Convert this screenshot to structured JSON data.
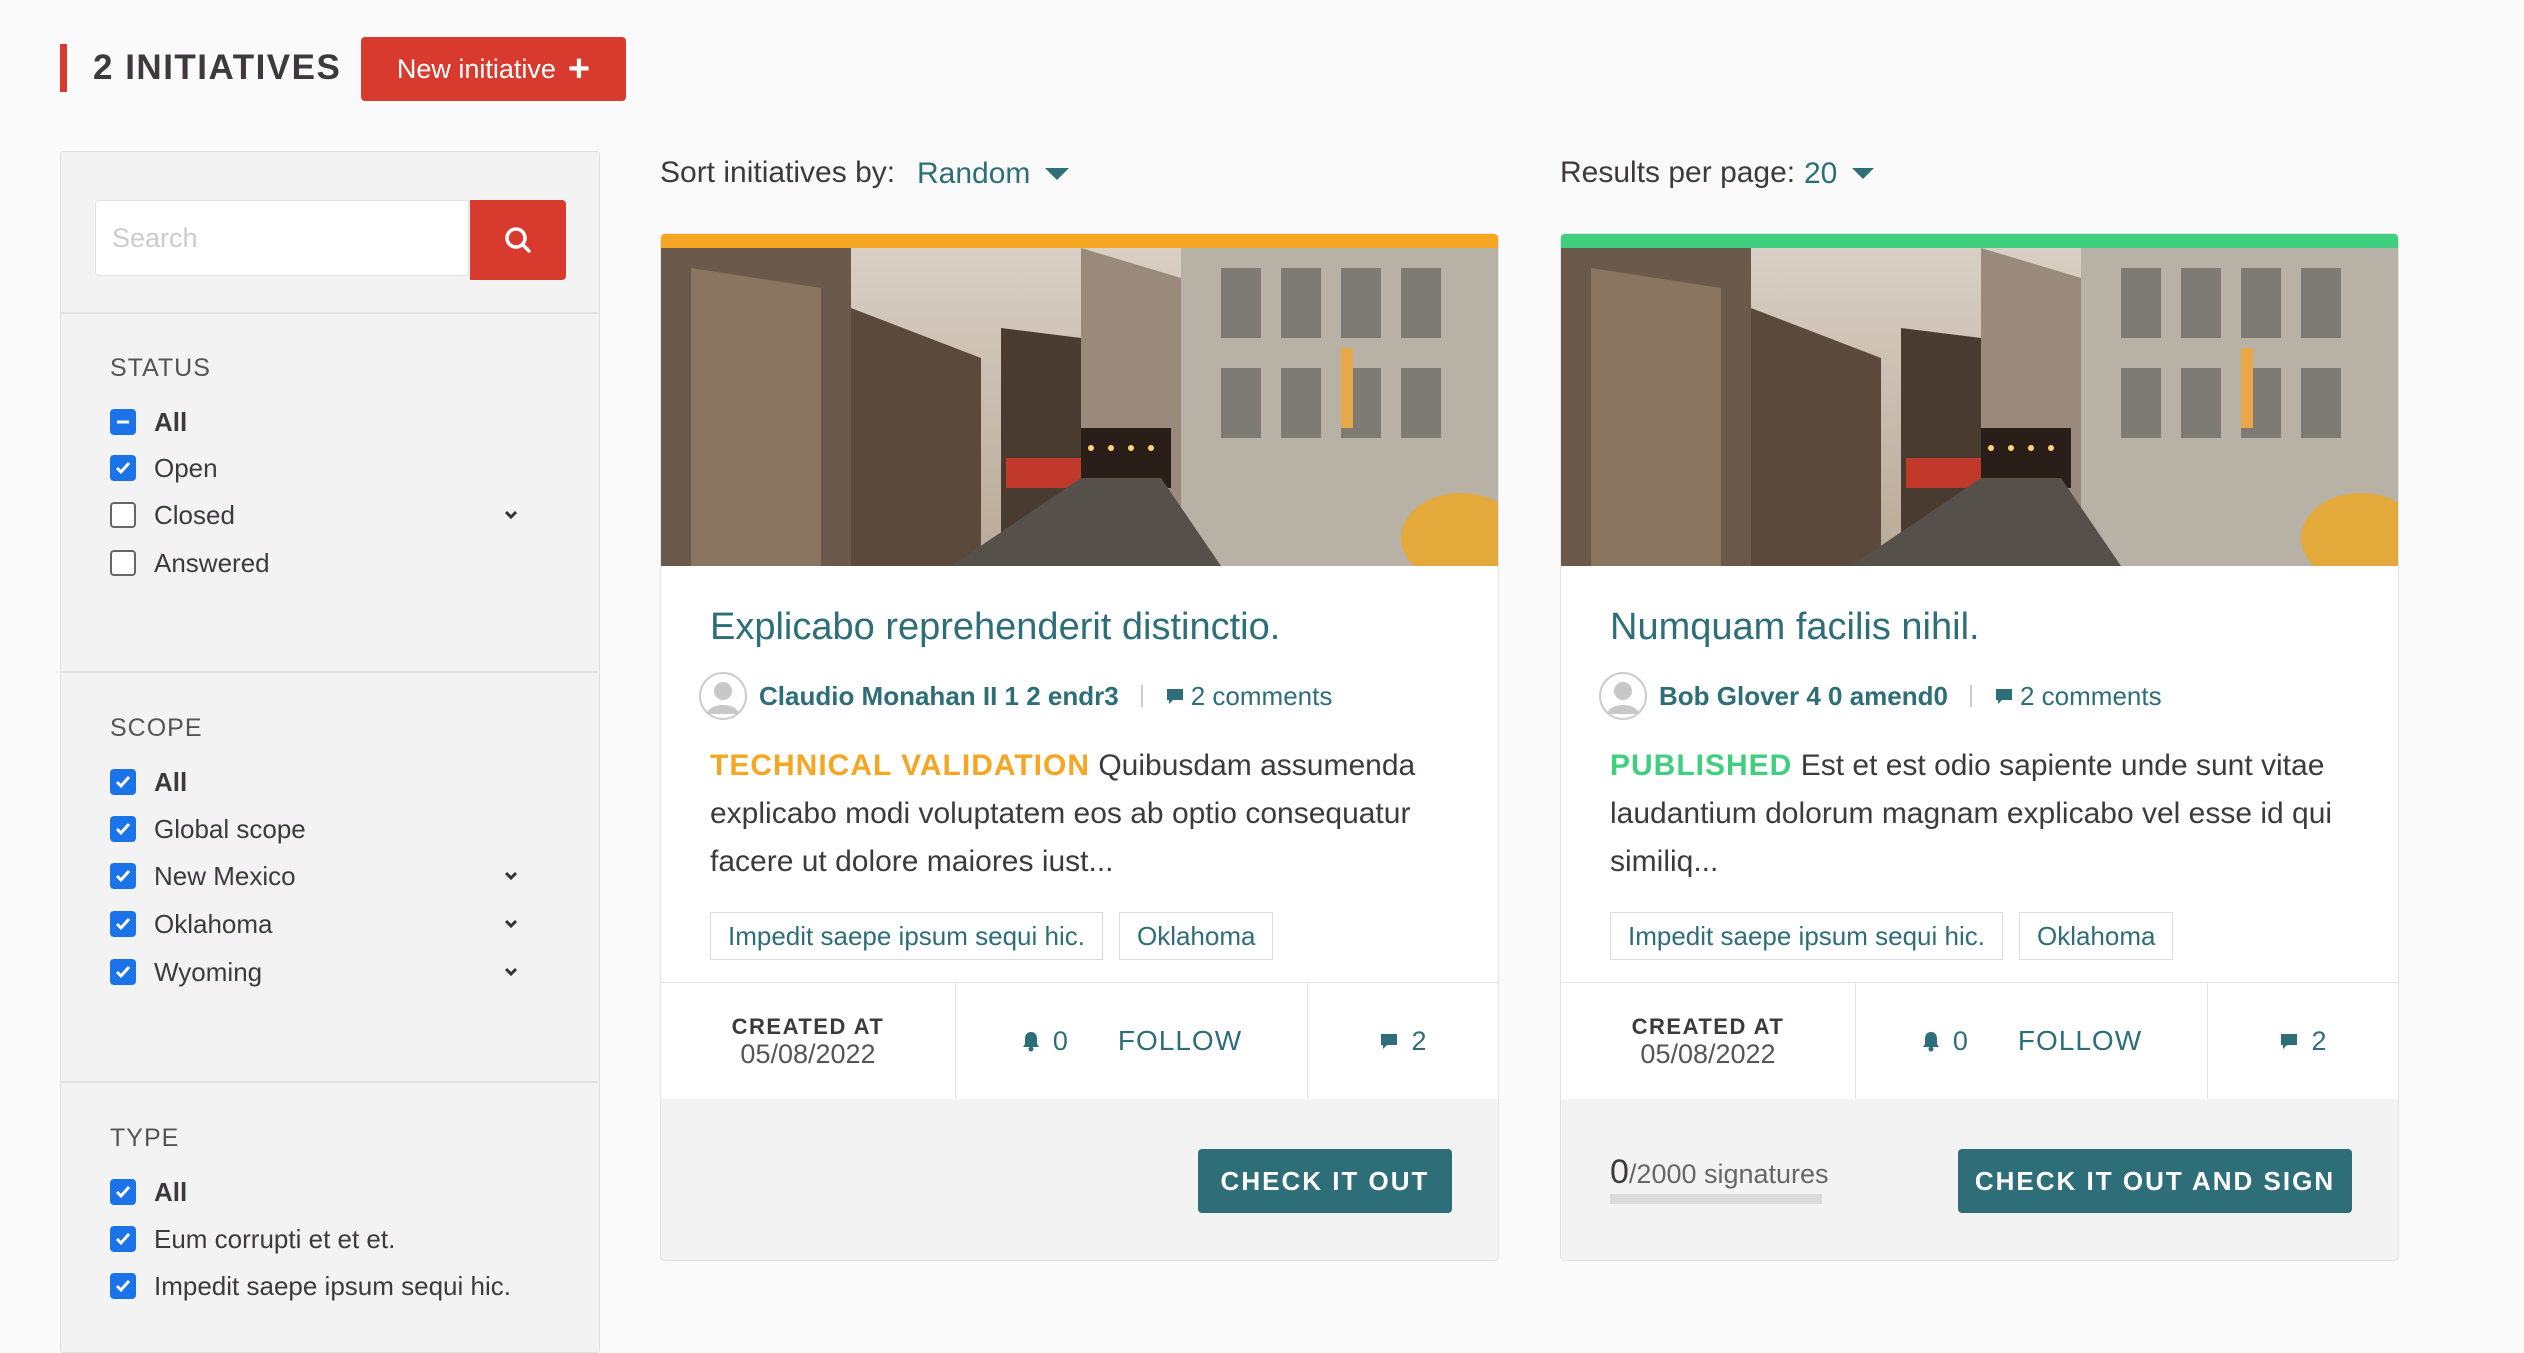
{
  "header": {
    "title": "2 INITIATIVES",
    "new_button": "New initiative",
    "accent": "#d93a2e"
  },
  "search": {
    "placeholder": "Search"
  },
  "filters": {
    "status": {
      "title": "STATUS",
      "items": [
        {
          "label": "All",
          "state": "indeterminate"
        },
        {
          "label": "Open",
          "state": "checked"
        },
        {
          "label": "Closed",
          "state": "unchecked",
          "expandable": true
        },
        {
          "label": "Answered",
          "state": "unchecked"
        }
      ]
    },
    "scope": {
      "title": "SCOPE",
      "items": [
        {
          "label": "All",
          "state": "checked"
        },
        {
          "label": "Global scope",
          "state": "checked"
        },
        {
          "label": "New Mexico",
          "state": "checked",
          "expandable": true
        },
        {
          "label": "Oklahoma",
          "state": "checked",
          "expandable": true
        },
        {
          "label": "Wyoming",
          "state": "checked",
          "expandable": true
        }
      ]
    },
    "type": {
      "title": "TYPE",
      "items": [
        {
          "label": "All",
          "state": "checked"
        },
        {
          "label": "Eum corrupti et et et.",
          "state": "checked"
        },
        {
          "label": "Impedit saepe ipsum sequi hic.",
          "state": "checked"
        }
      ]
    }
  },
  "controls": {
    "sort_label": "Sort initiatives by:",
    "sort_value": "Random",
    "per_page_label": "Results per page:",
    "per_page_value": "20"
  },
  "cards": [
    {
      "title": "Explicabo reprehenderit distinctio.",
      "author": "Claudio Monahan II 1 2 endr3",
      "comments": "2 comments",
      "state_label": "TECHNICAL VALIDATION",
      "state_color": "#f5a623",
      "description": "Quibusdam assumenda explicabo modi voluptatem eos ab optio consequatur facere ut dolore maiores iust...",
      "tags": [
        "Impedit saepe ipsum sequi hic.",
        "Oklahoma"
      ],
      "created_label": "CREATED AT",
      "created_date": "05/08/2022",
      "followers": "0",
      "follow": "FOLLOW",
      "comment_count": "2",
      "cta": "CHECK IT OUT"
    },
    {
      "title": "Numquam facilis nihil.",
      "author": "Bob Glover 4 0 amend0",
      "comments": "2 comments",
      "state_label": "PUBLISHED",
      "state_color": "#3fcf7f",
      "description": "Est et est odio sapiente unde sunt vitae laudantium dolorum magnam explicabo vel esse id qui similiq...",
      "tags": [
        "Impedit saepe ipsum sequi hic.",
        "Oklahoma"
      ],
      "created_label": "CREATED AT",
      "created_date": "05/08/2022",
      "followers": "0",
      "follow": "FOLLOW",
      "comment_count": "2",
      "signatures_count": "0",
      "signatures_total": "/2000 signatures",
      "cta": "CHECK IT OUT AND SIGN"
    }
  ]
}
